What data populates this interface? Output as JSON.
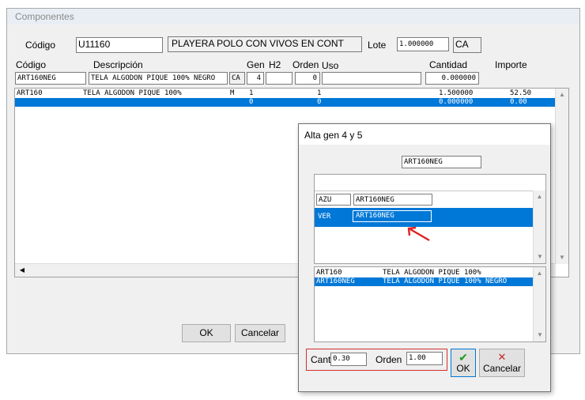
{
  "main": {
    "title": "Componentes",
    "codigo_label": "Código",
    "codigo_value": "U11160",
    "descripcion_value": "PLAYERA POLO CON VIVOS EN CONT",
    "lote_label": "Lote",
    "lote_value": "1.000000",
    "lote_unit": "CA",
    "headers": {
      "codigo": "Código",
      "descripcion": "Descripción",
      "gen": "Gen",
      "h2": "H2",
      "orden": "Orden",
      "uso": "Uso",
      "cantidad": "Cantidad",
      "importe": "Importe"
    },
    "edit_row": {
      "codigo": "ART160NEG",
      "descripcion": "TELA ALGODON PIQUE 100% NEGRO",
      "unidad": "CA",
      "gen": "4",
      "h2": "",
      "orden": "0",
      "uso": "",
      "cantidad": "0.000000"
    },
    "rows": [
      {
        "codigo": "ART160",
        "descripcion": "TELA ALGODON PIQUE 100%",
        "flag": "M",
        "gen": "1",
        "orden": "1",
        "cantidad": "1.500000",
        "importe": "52.50"
      },
      {
        "codigo": "",
        "descripcion": "",
        "flag": "",
        "gen": "0",
        "orden": "0",
        "cantidad": "0.000000",
        "importe": "0.00"
      }
    ],
    "ok_label": "OK",
    "cancel_label": "Cancelar"
  },
  "dialog": {
    "title": "Alta gen 4 y 5",
    "code_value": "ART160NEG",
    "gen_rows": [
      {
        "code": "AZU",
        "art": "ART160NEG"
      },
      {
        "code": "VER",
        "art": "ART160NEG"
      }
    ],
    "art_rows": [
      {
        "codigo": "ART160",
        "descripcion": "TELA ALGODON PIQUE 100%"
      },
      {
        "codigo": "ART160NEG",
        "descripcion": "TELA ALGODON PIQUE 100% NEGRO"
      }
    ],
    "cant_label": "Cant",
    "cant_value": "0.30",
    "orden_label": "Orden",
    "orden_value": "1.00",
    "ok_label": "OK",
    "cancel_label": "Cancelar"
  },
  "colors": {
    "selection": "#0078d7",
    "highlight_box": "#d32f2f",
    "arrow": "#e02020"
  }
}
